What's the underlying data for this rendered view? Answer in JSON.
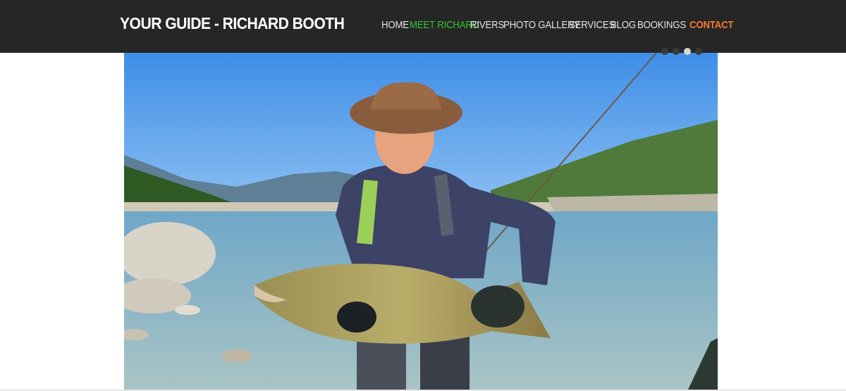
{
  "header": {
    "site_title": "YOUR GUIDE - RICHARD BOOTH",
    "nav": [
      {
        "label": "HOME"
      },
      {
        "label": "MEET RICHARD",
        "active": true
      },
      {
        "label": "RIVERS"
      },
      {
        "label": "PHOTO GALLERY"
      },
      {
        "label": "SERVICES"
      },
      {
        "label": "BLOG"
      },
      {
        "label": "BOOKINGS"
      },
      {
        "label": "CONTACT"
      }
    ]
  },
  "slider": {
    "slide_count": 4,
    "active_slide": 3
  },
  "colors": {
    "header_bg": "#262626",
    "nav_text": "#e3e3e3",
    "nav_active": "#33c233",
    "nav_contact": "#f47a34"
  }
}
